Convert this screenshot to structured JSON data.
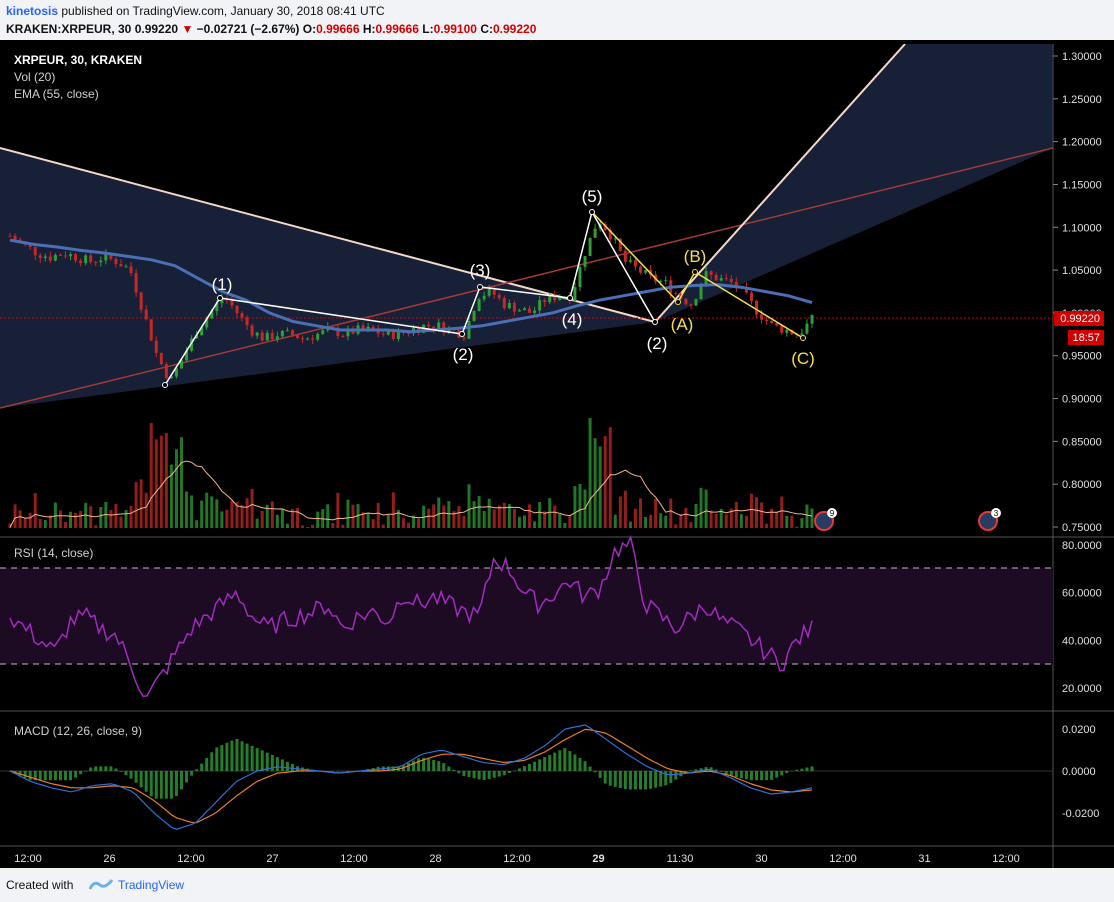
{
  "header": {
    "author": "kinetosis",
    "published": "published on TradingView.com, January 30, 2018 08:41 UTC",
    "symbol": "KRAKEN:XRPEUR, 30",
    "last": "0.99220",
    "change": "−0.02721 (−2.67%)",
    "o_label": "O:",
    "o": "0.99666",
    "h_label": "H:",
    "h": "0.99666",
    "l_label": "L:",
    "l": "0.99100",
    "c_label": "C:",
    "c": "0.99220"
  },
  "legend": {
    "title": "XRPEUR, 30, KRAKEN",
    "vol": "Vol (20)",
    "ema": "EMA (55, close)"
  },
  "price_axis": {
    "ticks": [
      "1.30000",
      "1.25000",
      "1.20000",
      "1.15000",
      "1.10000",
      "1.05000",
      "1.00000",
      "0.95000",
      "0.90000",
      "0.85000",
      "0.80000",
      "0.75000"
    ],
    "last_price_tag": "0.99220",
    "countdown_tag": "18:57"
  },
  "rsi": {
    "label": "RSI (14, close)",
    "ticks": [
      "80.0000",
      "60.0000",
      "40.0000",
      "20.0000"
    ]
  },
  "macd": {
    "label": "MACD (12, 26, close, 9)",
    "ticks": [
      "0.0200",
      "0.0000",
      "-0.0200"
    ]
  },
  "time_axis": [
    "12:00",
    "26",
    "12:00",
    "27",
    "12:00",
    "28",
    "12:00",
    "29",
    "11:30",
    "30",
    "12:00",
    "31",
    "12:00"
  ],
  "wave_labels": {
    "w1": "(1)",
    "w2a": "(2)",
    "w3": "(3)",
    "w4": "(4)",
    "w5": "(5)",
    "w2b": "(2)",
    "A": "(A)",
    "B": "(B)",
    "C": "(C)"
  },
  "event_badges": [
    "9",
    "3"
  ],
  "footer": {
    "created": "Created with",
    "brand": "TradingView"
  },
  "colors": {
    "up": "#2e9e36",
    "down": "#c62828",
    "ema": "#4a6fb5",
    "rsi": "#a32bc0",
    "macd": "#2f6fd6",
    "signal": "#e97d24",
    "label_white": "#ffffff",
    "label_yellow": "#f6e04a",
    "trendline": "#f5d9c8",
    "wave_line": "#f6e04a"
  },
  "chart_data": {
    "type": "candlestick",
    "symbol": "XRPEUR",
    "interval": "30",
    "exchange": "KRAKEN",
    "ylim": [
      0.74,
      1.31
    ],
    "rsi_ylim": [
      10,
      82
    ],
    "macd_ylim": [
      -0.031,
      0.025
    ],
    "elliott_waves": [
      {
        "label": "(1)",
        "price": 1.02
      },
      {
        "label": "(2)",
        "price": 0.975
      },
      {
        "label": "(3)",
        "price": 1.03
      },
      {
        "label": "(4)",
        "price": 1.02
      },
      {
        "label": "(5)",
        "price": 1.115
      },
      {
        "label": "(2)",
        "price": 0.99
      },
      {
        "label": "(A)",
        "price": 1.01
      },
      {
        "label": "(B)",
        "price": 1.047
      },
      {
        "label": "(C)",
        "price": 0.97
      }
    ],
    "price_path": [
      1.09,
      1.08,
      1.07,
      1.065,
      1.07,
      1.065,
      1.06,
      1.065,
      1.06,
      1.05,
      1.0,
      0.95,
      0.92,
      0.95,
      0.98,
      1.0,
      1.02,
      1.0,
      0.98,
      0.97,
      0.975,
      0.975,
      0.97,
      0.975,
      0.98,
      0.975,
      0.98,
      0.98,
      0.975,
      0.975,
      0.98,
      0.985,
      0.985,
      0.98,
      0.975,
      1.02,
      1.025,
      1.01,
      1.005,
      1.0,
      1.015,
      1.02,
      1.02,
      1.07,
      1.11,
      1.09,
      1.06,
      1.05,
      1.04,
      1.035,
      1.02,
      1.01,
      1.045,
      1.04,
      1.035,
      1.02,
      1.0,
      0.985,
      0.98,
      0.975,
      0.992
    ],
    "ema_path": [
      1.085,
      1.08,
      1.077,
      1.073,
      1.07,
      1.066,
      1.062,
      1.055,
      1.04,
      1.025,
      1.015,
      1.0,
      0.99,
      0.985,
      0.98,
      0.98,
      0.98,
      0.978,
      0.98,
      0.982,
      0.985,
      0.99,
      0.995,
      1.0,
      1.008,
      1.015,
      1.02,
      1.025,
      1.03,
      1.032,
      1.033,
      1.03,
      1.025,
      1.02,
      1.012
    ],
    "rsi_path": [
      50,
      45,
      40,
      35,
      48,
      50,
      45,
      42,
      30,
      15,
      25,
      35,
      45,
      50,
      55,
      60,
      50,
      45,
      48,
      50,
      52,
      55,
      45,
      50,
      52,
      48,
      60,
      55,
      58,
      55,
      52,
      50,
      75,
      70,
      60,
      55,
      60,
      65,
      58,
      62,
      78,
      80,
      55,
      50,
      45,
      50,
      55,
      48,
      45,
      40,
      35,
      30,
      40,
      45
    ],
    "macd_path": [
      0.0,
      -0.005,
      -0.008,
      -0.01,
      -0.007,
      -0.006,
      -0.01,
      -0.02,
      -0.028,
      -0.025,
      -0.015,
      -0.005,
      0.0,
      0.002,
      0.001,
      0.0,
      -0.001,
      0.0,
      0.001,
      0.002,
      0.008,
      0.01,
      0.007,
      0.004,
      0.003,
      0.006,
      0.012,
      0.02,
      0.022,
      0.015,
      0.008,
      0.002,
      -0.002,
      -0.001,
      0.001,
      -0.003,
      -0.008,
      -0.011,
      -0.01,
      -0.008
    ],
    "signal_path": [
      0.0,
      -0.003,
      -0.006,
      -0.008,
      -0.008,
      -0.007,
      -0.008,
      -0.014,
      -0.022,
      -0.025,
      -0.02,
      -0.012,
      -0.005,
      -0.001,
      0.0,
      0.0,
      -0.001,
      0.0,
      0.0,
      0.001,
      0.005,
      0.008,
      0.008,
      0.006,
      0.004,
      0.005,
      0.009,
      0.015,
      0.02,
      0.018,
      0.012,
      0.006,
      0.001,
      -0.001,
      0.0,
      -0.002,
      -0.006,
      -0.009,
      -0.01,
      -0.009
    ]
  }
}
